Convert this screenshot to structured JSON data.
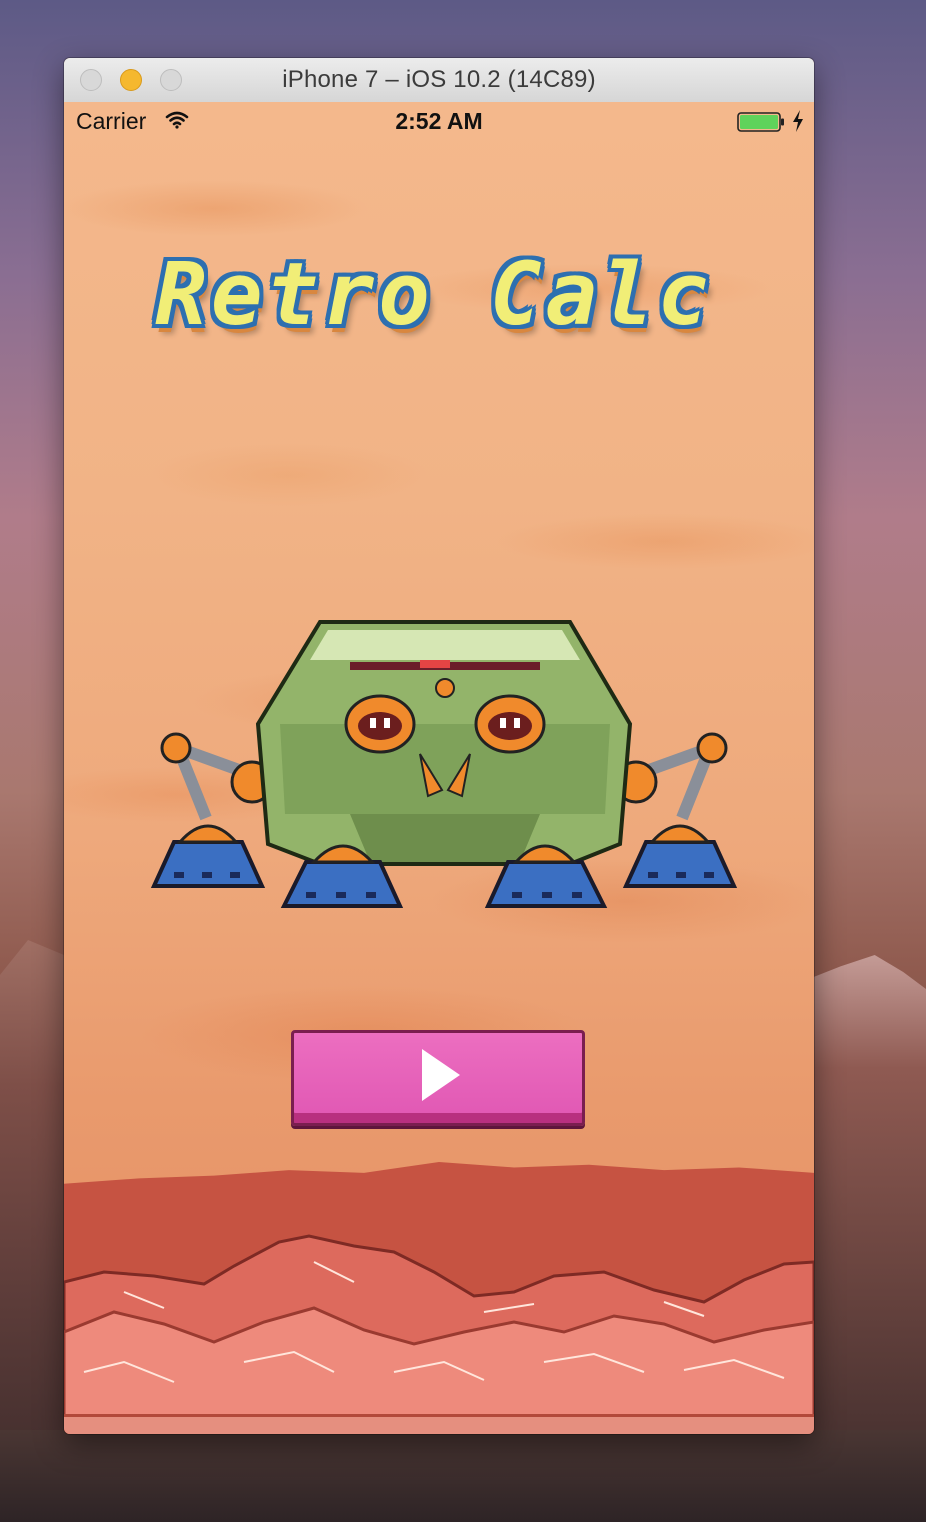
{
  "window": {
    "title": "iPhone 7 – iOS 10.2 (14C89)"
  },
  "status_bar": {
    "carrier": "Carrier",
    "time": "2:52 AM",
    "battery_color": "#5fd35b"
  },
  "app": {
    "title": "Retro Calc",
    "play_button_color": "#e65db8",
    "background_color": "#f0b589"
  },
  "icons": {
    "wifi": "wifi-icon",
    "battery": "battery-icon",
    "charging": "charging-bolt-icon",
    "play": "play-icon"
  }
}
